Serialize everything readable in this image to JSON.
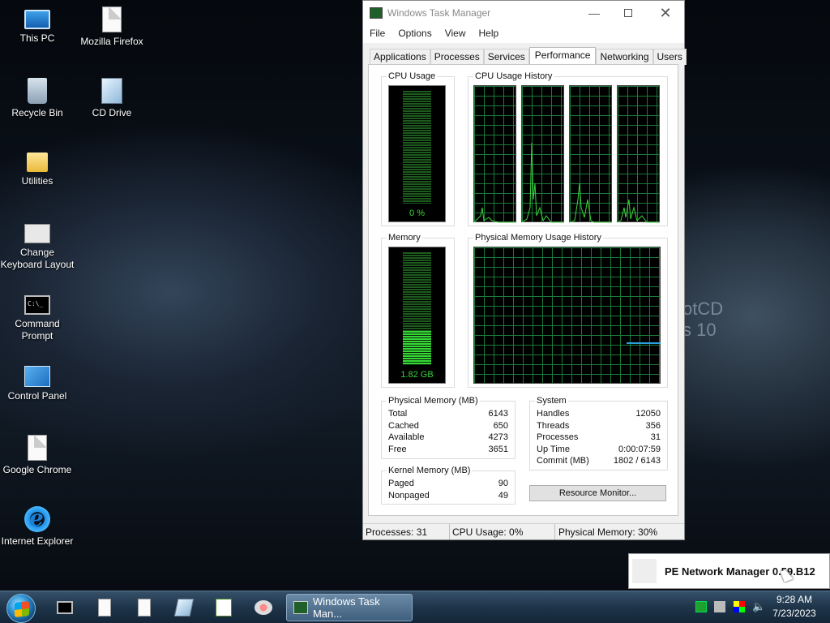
{
  "desktop": {
    "icons": [
      {
        "label": "This PC"
      },
      {
        "label": "Mozilla Firefox"
      },
      {
        "label": "Recycle Bin"
      },
      {
        "label": "CD Drive"
      },
      {
        "label": "Utilities"
      },
      {
        "label": "Change Keyboard Layout"
      },
      {
        "label": "Command Prompt"
      },
      {
        "label": "Control Panel"
      },
      {
        "label": "Google Chrome"
      },
      {
        "label": "Internet Explorer"
      }
    ],
    "brand_text_1": "otCD",
    "brand_text_2": "s 10"
  },
  "taskmgr": {
    "title": "Windows Task Manager",
    "menu": [
      "File",
      "Options",
      "View",
      "Help"
    ],
    "tabs": [
      "Applications",
      "Processes",
      "Services",
      "Performance",
      "Networking",
      "Users"
    ],
    "active_tab": "Performance",
    "cpu_usage_label": "CPU Usage",
    "cpu_usage_value": "0 %",
    "cpu_usage_level": 0,
    "cpu_history_label": "CPU Usage History",
    "memory_label": "Memory",
    "memory_value": "1.82 GB",
    "memory_level": 0.3,
    "mem_history_label": "Physical Memory Usage History",
    "physical_memory": {
      "label": "Physical Memory (MB)",
      "rows": [
        {
          "name": "Total",
          "value": "6143"
        },
        {
          "name": "Cached",
          "value": "650"
        },
        {
          "name": "Available",
          "value": "4273"
        },
        {
          "name": "Free",
          "value": "3651"
        }
      ]
    },
    "kernel_memory": {
      "label": "Kernel Memory (MB)",
      "rows": [
        {
          "name": "Paged",
          "value": "90"
        },
        {
          "name": "Nonpaged",
          "value": "49"
        }
      ]
    },
    "system": {
      "label": "System",
      "rows": [
        {
          "name": "Handles",
          "value": "12050"
        },
        {
          "name": "Threads",
          "value": "356"
        },
        {
          "name": "Processes",
          "value": "31"
        },
        {
          "name": "Up Time",
          "value": "0:00:07:59"
        },
        {
          "name": "Commit (MB)",
          "value": "1802 / 6143"
        }
      ]
    },
    "resource_monitor_button": "Resource Monitor...",
    "status": {
      "processes": "Processes: 31",
      "cpu": "CPU Usage: 0%",
      "memory": "Physical Memory: 30%"
    }
  },
  "notification": {
    "text": "PE Network Manager 0.59.B12"
  },
  "taskbar": {
    "active_window": "Windows Task Man...",
    "clock_time": "9:28 AM",
    "clock_date": "7/23/2023"
  },
  "colors": {
    "graph_grid": "#1b7a3a",
    "graph_line": "#3bd43b",
    "memory_line": "#2a9fe0"
  }
}
